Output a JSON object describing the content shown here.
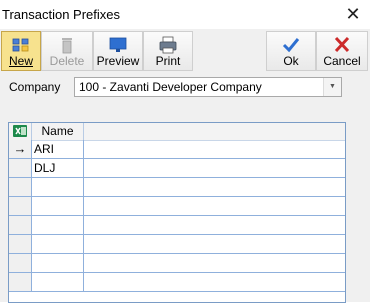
{
  "window": {
    "title": "Transaction Prefixes",
    "close_glyph": "✕"
  },
  "toolbar": {
    "new_label": "New",
    "delete_label": "Delete",
    "preview_label": "Preview",
    "print_label": "Print",
    "ok_label": "Ok",
    "cancel_label": "Cancel"
  },
  "company": {
    "label": "Company",
    "value": "100 - Zavanti Developer Company"
  },
  "grid": {
    "column_header": "Name",
    "rows": [
      {
        "indicator": "→",
        "name": "ARI"
      },
      {
        "indicator": "",
        "name": "DLJ"
      },
      {
        "indicator": "",
        "name": ""
      },
      {
        "indicator": "",
        "name": ""
      },
      {
        "indicator": "",
        "name": ""
      },
      {
        "indicator": "",
        "name": ""
      },
      {
        "indicator": "",
        "name": ""
      },
      {
        "indicator": "",
        "name": ""
      }
    ]
  },
  "colors": {
    "accent_blue": "#2e6fd0",
    "cancel_red": "#cc2a2a",
    "new_active": "#f7e28e"
  }
}
